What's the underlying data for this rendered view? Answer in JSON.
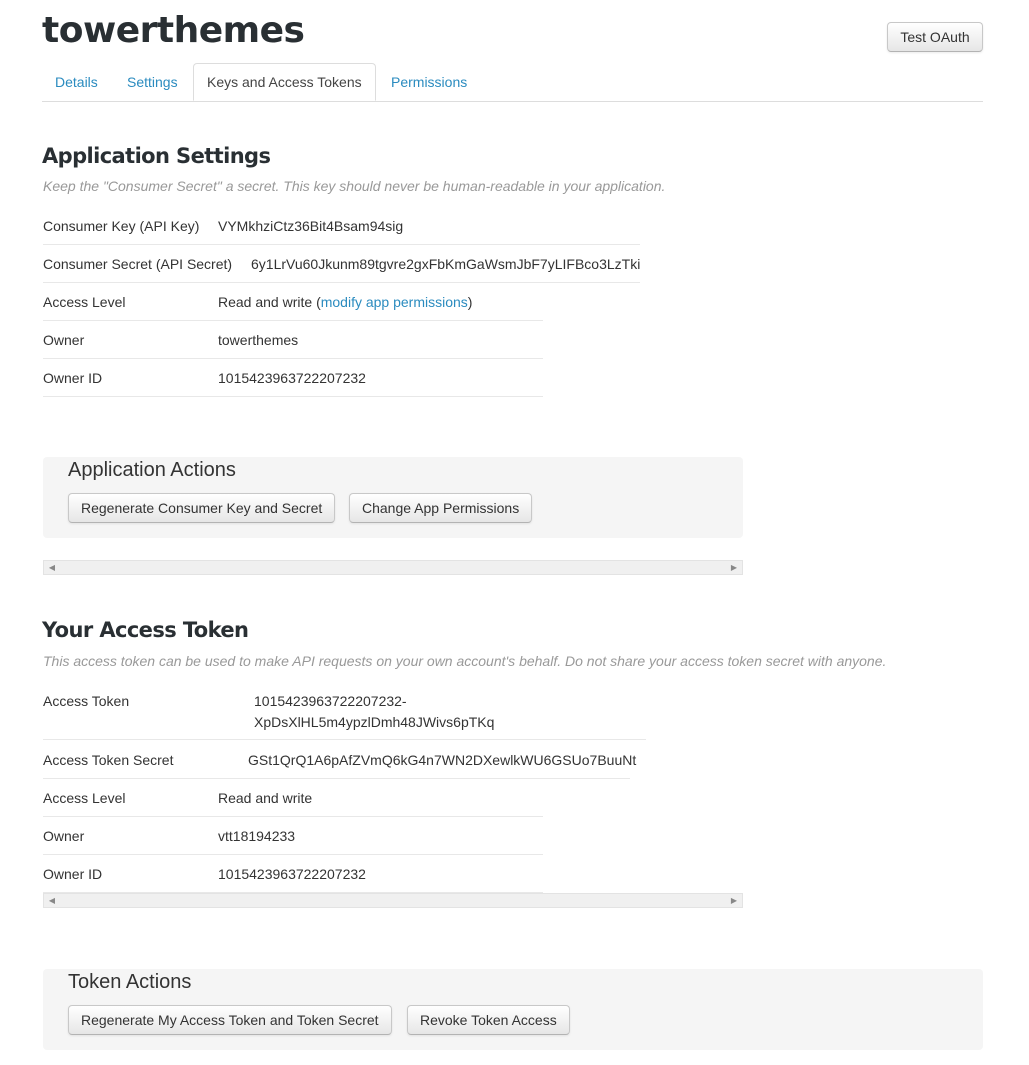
{
  "app": {
    "title": "towerthemes"
  },
  "header": {
    "test_oauth_label": "Test OAuth"
  },
  "tabs": [
    {
      "label": "Details"
    },
    {
      "label": "Settings"
    },
    {
      "label": "Keys and Access Tokens",
      "active": true
    },
    {
      "label": "Permissions"
    }
  ],
  "app_settings": {
    "title": "Application Settings",
    "description": "Keep the \"Consumer Secret\" a secret. This key should never be human-readable in your application.",
    "consumer_key_label": "Consumer Key (API Key)",
    "consumer_key": "VYMkhziCtz36Bit4Bsam94sig",
    "consumer_secret_label": "Consumer Secret (API Secret)",
    "consumer_secret": "6y1LrVu60Jkunm89tgvre2gxFbKmGaWsmJbF7yLIFBco3LzTki",
    "access_level_label": "Access Level",
    "access_level": "Read and write",
    "access_level_open": "(",
    "modify_link": "modify app permissions",
    "access_level_close": ")",
    "owner_label": "Owner",
    "owner": "towerthemes",
    "owner_id_label": "Owner ID",
    "owner_id": "1015423963722207232"
  },
  "app_actions": {
    "title": "Application Actions",
    "regenerate_label": "Regenerate Consumer Key and Secret",
    "change_perms_label": "Change App Permissions"
  },
  "access_token": {
    "title": "Your Access Token",
    "description": "This access token can be used to make API requests on your own account's behalf. Do not share your access token secret with anyone.",
    "token_label": "Access Token",
    "token_line1": "1015423963722207232-",
    "token_line2": "XpDsXlHL5m4ypzlDmh48JWivs6pTKq",
    "secret_label": "Access Token Secret",
    "secret": "GSt1QrQ1A6pAfZVmQ6kG4n7WN2DXewlkWU6GSUo7BuuNt",
    "access_level_label": "Access Level",
    "access_level": "Read and write",
    "owner_label": "Owner",
    "owner": "vtt18194233",
    "owner_id_label": "Owner ID",
    "owner_id": "1015423963722207232"
  },
  "token_actions": {
    "title": "Token Actions",
    "regenerate_label": "Regenerate My Access Token and Token Secret",
    "revoke_label": "Revoke Token Access"
  },
  "icons": {
    "scroll_left": "scroll-left-arrow-icon",
    "scroll_right": "scroll-right-arrow-icon"
  },
  "colors": {
    "link": "#2a8bbf",
    "heading": "#292f33",
    "muted": "#999999"
  }
}
